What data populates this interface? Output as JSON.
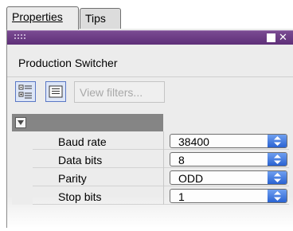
{
  "tabs": [
    {
      "label": "Properties",
      "active": true
    },
    {
      "label": "Tips",
      "active": false
    }
  ],
  "panel": {
    "title": "Production Switcher",
    "titlebar_color": "#5e2f78",
    "maximize_icon": "square-icon",
    "close_icon": "close-icon"
  },
  "toolbar": {
    "categorized_icon": "categorized-view-icon",
    "list_icon": "list-view-icon",
    "filters_label": "View filters..."
  },
  "properties": [
    {
      "label": "Baud rate",
      "value": "38400"
    },
    {
      "label": "Data bits",
      "value": "8"
    },
    {
      "label": "Parity",
      "value": "ODD"
    },
    {
      "label": "Stop bits",
      "value": "1"
    }
  ],
  "colors": {
    "spinner_top": "#6f9ff0",
    "spinner_bottom": "#2a63d2",
    "group_header": "#858585"
  }
}
